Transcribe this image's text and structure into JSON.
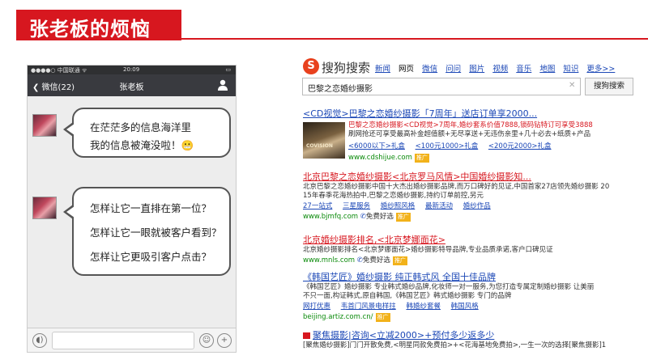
{
  "slide_title": "张老板的烦恼",
  "phone": {
    "status": {
      "carrier": "●●●●○ 中国联通 ᯤ",
      "time": "20:09",
      "battery": "▭"
    },
    "nav": {
      "back": "❮ 微信(22)",
      "contact": "张老板"
    },
    "bubble1": {
      "line1": "在茫茫多的信息海洋里",
      "line2": "我的信息被淹没啦！😬"
    },
    "bubble2": {
      "line1": "怎样让它一直排在第一位？",
      "line2": "怎样让它一眼就被客户看到？",
      "line3": "怎样让它更吸引客户点击？"
    }
  },
  "sogou": {
    "logo": "S",
    "brand": "搜狗搜索",
    "nav": [
      "新闻",
      "网页",
      "微信",
      "问问",
      "图片",
      "视频",
      "音乐",
      "地图",
      "知识",
      "更多>>"
    ],
    "query": "巴黎之恋婚纱摄影",
    "button": "搜狗搜索",
    "results": [
      {
        "title": "<CD视觉>巴黎之恋婚纱摄影「7周年」送店订单享2000...",
        "line1": "巴黎之恋婚纱摄影<CD视觉>7周年,婚纱套系价值7888,锁码钻特订可享受3888",
        "line2": "刷网抢还可享受最高补金超值额+无尽享送+无违伤亲里+几十必去+纸质+产品",
        "thumb_text": "COVISION",
        "links": [
          "<6000以下>礼盒",
          "<100元1000>礼盒",
          "<200元2000>礼盒"
        ],
        "url": "www.cdshijue.com",
        "tag": "推广"
      },
      {
        "title": "北京巴黎之恋婚纱摄影<北京罗马风情>中国婚纱摄影知...",
        "line1": "北京巴黎之恋婚纱摄影中国十大杰出婚纱摄影品牌,而万口碑好的见证,中国首家27店领先婚纱摄影 20",
        "line2": "15年春季花海热拍中,巴黎之恋婚纱摄影,持约订单前控,另元",
        "links": [
          "27一站式",
          "三星服务",
          "婚纱照风格",
          "最新活动",
          "婚纱作品"
        ],
        "url": "www.bjmfq.com",
        "trust": "免费好选",
        "tag": "推广"
      },
      {
        "title": "北京婚纱摄影排名,<北京梦娜面花>",
        "line1": "北京婚纱摄影排名<北京梦娜面花>婚纱摄影特导品牌,专业品质承诺,客户口碑见证",
        "url": "www.mnls.com",
        "trust": "免费好选",
        "tag": "推广"
      },
      {
        "title": "《韩国艺匠》婚纱摄影 纯正韩式风 全国十佳品牌",
        "line1": "《韩国艺匠》婚纱摄影 专业韩式婚纱品牌,化妆师一对一服务,为您打造专属定制婚纱摄影 让美丽",
        "line2": "不只一面,构证韩式,原自韩国,《韩国艺匠》韩式婚纱摄影 专门的品牌",
        "links": [
          "网打优惠",
          "韦首门风景电样拄",
          "韩婚纱套餐",
          "韩国风格"
        ],
        "url": "beijing.artiz.com.cn/",
        "tag": "推广"
      },
      {
        "title": "聚焦摄影|咨询<立减2000>+预付多少返多少",
        "line1": "[聚焦婚纱摄影]门门开散免费,<明星同款免费拍>+<花海基地免费拍>,一生一次的选择[聚焦摄影]1"
      }
    ]
  },
  "colors": {
    "brand_red": "#d7171f",
    "link_blue": "#1b47b6",
    "url_green": "#0a8a0a",
    "sogou_orange": "#e8411e"
  }
}
